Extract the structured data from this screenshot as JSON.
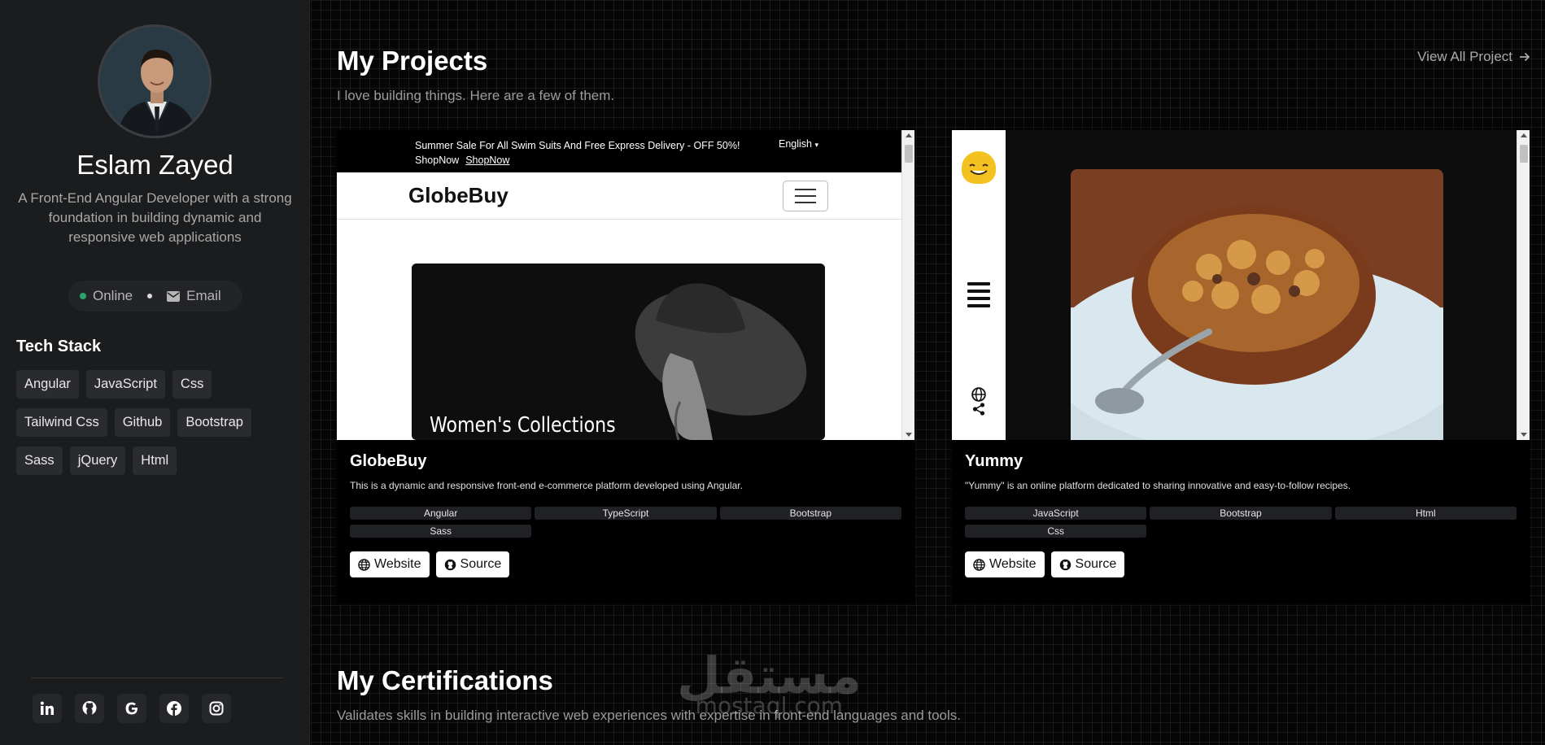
{
  "sidebar": {
    "name": "Eslam Zayed",
    "bio": "A Front-End Angular Developer with a strong foundation in building dynamic and responsive web applications",
    "status": {
      "online_label": "Online",
      "email_label": "Email",
      "online_color": "#2aa36b"
    },
    "tech_stack": {
      "title": "Tech Stack",
      "items": [
        "Angular",
        "JavaScript",
        "Css",
        "Tailwind Css",
        "Github",
        "Bootstrap",
        "Sass",
        "jQuery",
        "Html"
      ]
    },
    "socials": [
      "linkedin-icon",
      "github-icon",
      "google-icon",
      "facebook-icon",
      "instagram-icon"
    ]
  },
  "projects": {
    "title": "My Projects",
    "subtitle": "I love building things. Here are a few of them.",
    "view_all": "View All Project",
    "items": [
      {
        "name": "GlobeBuy",
        "description": "This is a dynamic and responsive front-end e-commerce platform developed using Angular.",
        "tags": [
          "Angular",
          "TypeScript",
          "Bootstrap",
          "Sass"
        ],
        "website_label": "Website",
        "source_label": "Source",
        "preview": {
          "promo": "Summer Sale For All Swim Suits And Free Express Delivery - OFF 50%!",
          "promo_link_1": "ShopNow",
          "promo_link_2": "ShopNow",
          "language": "English",
          "logo": "GlobeBuy",
          "hero_text": "Women's Collections"
        }
      },
      {
        "name": "Yummy",
        "description": "\"Yummy\" is an online platform dedicated to sharing innovative and easy-to-follow recipes.",
        "tags": [
          "JavaScript",
          "Bootstrap",
          "Html",
          "Css"
        ],
        "website_label": "Website",
        "source_label": "Source"
      }
    ]
  },
  "certifications": {
    "title": "My Certifications",
    "subtitle": "Validates skills in building interactive web experiences with expertise in front-end languages and tools."
  },
  "watermark": {
    "arabic": "مستقل",
    "latin": "mostaql.com"
  }
}
